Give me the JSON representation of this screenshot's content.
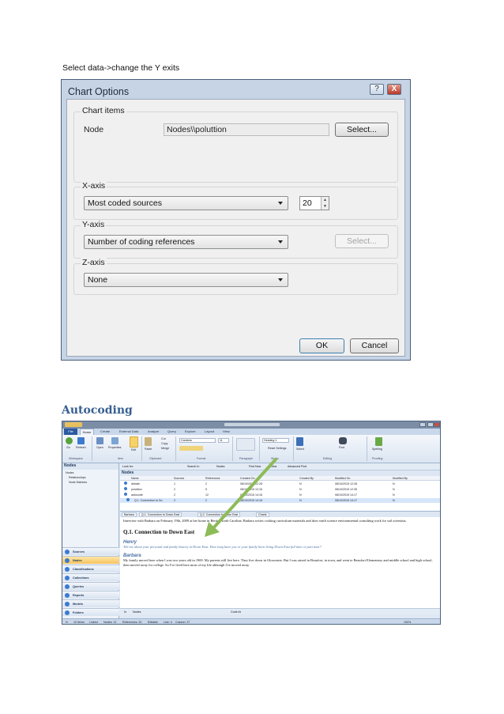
{
  "caption": "Select data->change the Y exits",
  "chart_options": {
    "title": "Chart Options",
    "help_glyph": "?",
    "close_glyph": "X",
    "chart_items": {
      "legend": "Chart items",
      "node_label": "Node",
      "node_value": "Nodes\\\\poluttion",
      "select_button": "Select..."
    },
    "x_axis": {
      "legend": "X-axis",
      "selected": "Most coded sources",
      "count": "20"
    },
    "y_axis": {
      "legend": "Y-axis",
      "selected": "Number of coding references",
      "select_button": "Select..."
    },
    "z_axis": {
      "legend": "Z-axis",
      "selected": "None"
    },
    "ok_button": "OK",
    "cancel_button": "Cancel"
  },
  "autocoding_heading": "Autocoding",
  "nvivo": {
    "tabs": [
      "File",
      "Home",
      "Create",
      "External Data",
      "Analyze",
      "Query",
      "Explore",
      "Layout",
      "View"
    ],
    "ribbon_groups": [
      "Workspace",
      "Item",
      "Clipboard",
      "Format",
      "Paragraph",
      "Styles",
      "Editing",
      "Proofing"
    ],
    "ribbon_buttons": [
      "Go",
      "Refresh",
      "Open",
      "Properties",
      "Edit",
      "Paste",
      "Cut",
      "Copy",
      "Merge",
      "Select",
      "Find",
      "Spelling"
    ],
    "font_name": "Cambria",
    "font_size": "11",
    "style_name": "Heading 1",
    "reset_settings": "Reset Settings",
    "navigation": {
      "header": "Nodes",
      "tree": [
        "Nodes",
        "Relationships",
        "Node Matrices"
      ],
      "buttons": [
        "Sources",
        "Nodes",
        "Classifications",
        "Collections",
        "Queries",
        "Reports",
        "Models",
        "Folders"
      ]
    },
    "find_bar": [
      "Look for:",
      "Search In",
      "Nodes",
      "Find Now",
      "Clear",
      "Advanced Find"
    ],
    "list": {
      "header": "Nodes",
      "columns": [
        "Name",
        "Sources",
        "References",
        "Created On",
        "Created By",
        "Modified On",
        "Modified By"
      ],
      "rows": [
        [
          "debate",
          "1",
          "2",
          "08/10/2015 12:28",
          "N",
          "08/10/2015 12:28",
          "N"
        ],
        [
          "poluttion",
          "2",
          "5",
          "08/10/2015 12:16",
          "N",
          "08/10/2015 12:35",
          "N"
        ],
        [
          "autocode",
          "2",
          "12",
          "08/10/2015 14:16",
          "N",
          "08/10/2015 14:17",
          "N"
        ],
        [
          "Q.1. Connection to Do",
          "2",
          "2",
          "08/10/2015 14:16",
          "N",
          "08/10/2015 14:17",
          "N"
        ]
      ]
    },
    "doc_tabs": [
      "Barbara",
      "Q.1. Connection to Down East",
      "Q.2. Connection to Down East",
      "Charts"
    ],
    "document": {
      "intro": "Interview with Barbara on February 19th, 2009 at her home in Bettie, North Carolina. Barbara writes cooking curriculum materials and does earth science environmental consulting work for soil scientists.",
      "heading": "Q.1. Connection to Down East",
      "speaker1": "Henry",
      "question": "Tell me about your personal and family history in Down East. How long have you or your family been living Down East full time or part time?",
      "speaker2": "Barbara",
      "answer": "My family moved here when I was two years old in 1969. My parents still live here. They live down in Gloucester. But I was raised in Beaufort, in town, and went to Beaufort Elementary and middle school and high school, then moved away for college. So I've lived here most of my life although I've moved away."
    },
    "code_bar": [
      "In",
      "Nodes",
      "Code At"
    ],
    "status_bar": [
      "N",
      "10 Items",
      "Linked",
      "Nodes: 12",
      "References: 20",
      "Editable",
      "Line: 4",
      "Column: 27",
      "100%"
    ]
  }
}
